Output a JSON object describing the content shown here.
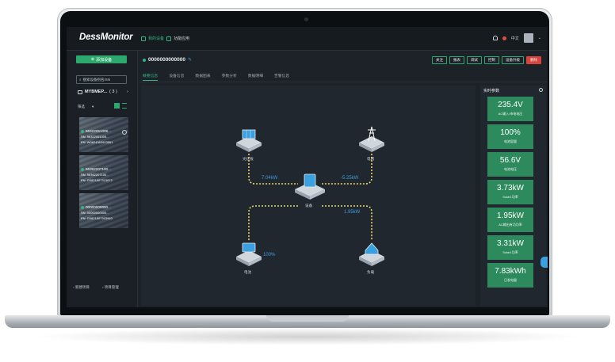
{
  "app": {
    "logo": "DessMonitor"
  },
  "topbar": {
    "nav": [
      {
        "label": "我的设备",
        "active": true
      },
      {
        "label": "功能应用",
        "active": false
      }
    ],
    "language": "中文"
  },
  "sidebar": {
    "add_button": "添加设备",
    "search_placeholder": "搜索设备别名/SN",
    "group_name": "MYBMEP...",
    "group_count": "( 3 )",
    "filter_label": "筛选",
    "devices": [
      {
        "name": "96322051009...",
        "sn": "SN: 96322051009...",
        "pn": "PN: W0824363903551"
      },
      {
        "name": "96362207100...",
        "sn": "SN: 96362207100...",
        "pn": "PN: G0821507313872"
      },
      {
        "name": "00000000000...",
        "sn": "SN: 00000000000...",
        "pn": "PN: G0821507303963"
      }
    ],
    "footer": [
      "新建项目",
      "项目管理"
    ]
  },
  "device": {
    "title": "0000000000000"
  },
  "actions": [
    "关注",
    "报表",
    "调试",
    "控制",
    "设备升级",
    "删除"
  ],
  "tabs": [
    "概要信息",
    "设备信息",
    "数据图表",
    "参数分析",
    "数据明细",
    "告警信息"
  ],
  "flow": {
    "nodes": {
      "pv": "光伏板",
      "grid": "电网",
      "device": "设备",
      "battery": "电池",
      "load": "负载"
    },
    "values": {
      "pv_power": "7.04kW",
      "grid_power": "-5.25kW",
      "load_power": "1.95kW",
      "battery_soc": "100%"
    }
  },
  "realtime": {
    "title": "实时参数",
    "metrics": [
      {
        "value": "235.4V",
        "label": "AC输入/市电电压"
      },
      {
        "value": "100%",
        "label": "电池容量"
      },
      {
        "value": "56.6V",
        "label": "电池电压"
      },
      {
        "value": "3.73kW",
        "label": "Solar1功率"
      },
      {
        "value": "1.95kW",
        "label": "AC输出有功功率"
      },
      {
        "value": "3.31kW",
        "label": "Solar1功率"
      },
      {
        "value": "7.83kWh",
        "label": "日发电量"
      }
    ]
  },
  "colors": {
    "accent": "#2ea96e",
    "flow_value": "#3aa0e0",
    "flow_line": "#e8d56a",
    "danger": "#d8433a"
  }
}
